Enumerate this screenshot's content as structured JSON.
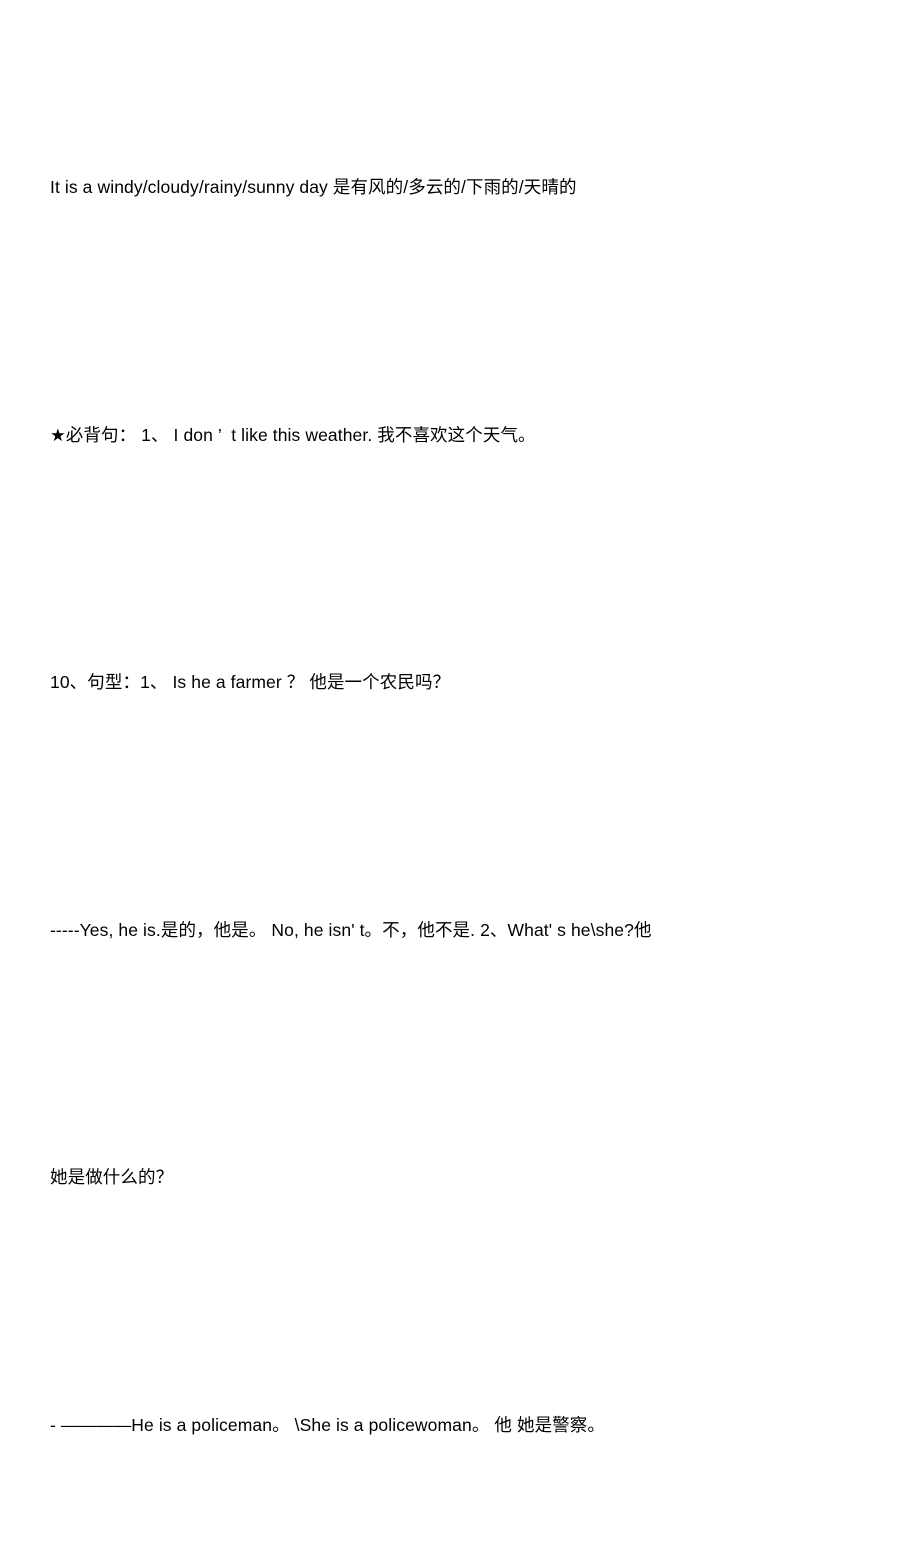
{
  "document": {
    "background_color": "#ffffff",
    "text_color": "#000000",
    "paragraphs": [
      {
        "id": "weather-sentence",
        "text": "It is a windy/cloudy/rainy/sunny day 是有风的/多云的/下雨的/天晴的"
      },
      {
        "id": "must-memorize-sentence",
        "text": "★必背句： 1、 I don ’  t like this weather. 我不喜欢这个天气。"
      },
      {
        "id": "section-10-sentence-patterns",
        "text": "10、句型：1、 Is he a farmer ？ 他是一个农民吗？"
      },
      {
        "id": "answer-yes-no-line",
        "text": "-----Yes, he is.是的，他是。 No, he isn' t。不，他不是. 2、What' s he\\she?他"
      },
      {
        "id": "what-does-she-do-line",
        "text": "她是做什么的？"
      },
      {
        "id": "policeman-policewoman-answer",
        "text": "- ————He is a policeman。 \\She is a policewoman。 他 她是警察。"
      }
    ]
  }
}
